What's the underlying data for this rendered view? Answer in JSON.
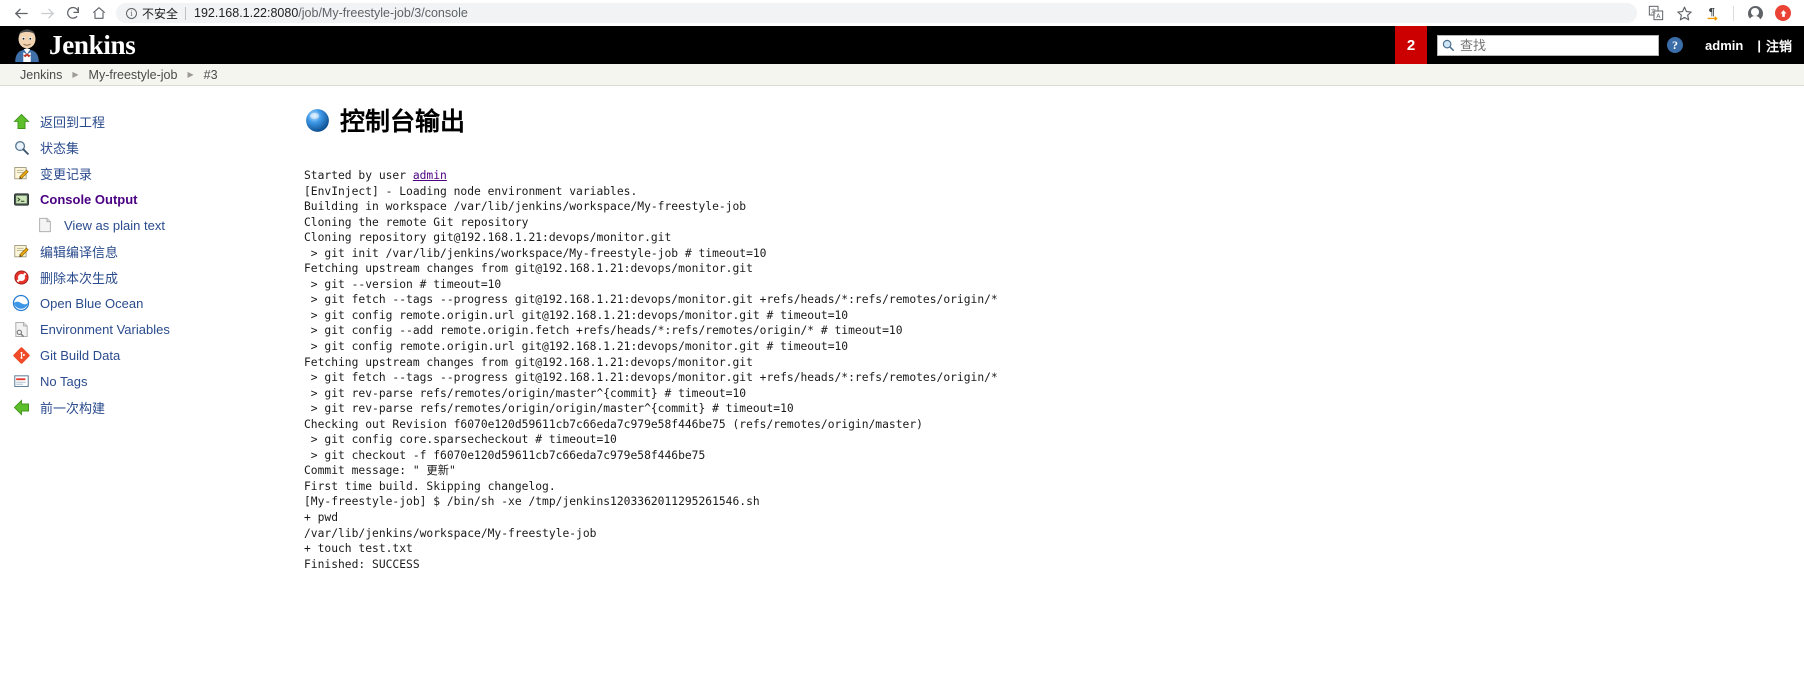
{
  "browser": {
    "back_icon": "arrow-left-icon",
    "forward_icon": "arrow-right-icon",
    "reload_icon": "reload-icon",
    "home_icon": "home-icon",
    "info_glyph": "i",
    "security_label": "不安全",
    "url_host": "192.168.1.22:8080",
    "url_path": "/job/My-freestyle-job/3/console",
    "translate_icon": "translate-icon",
    "bookmark_icon": "star-icon",
    "pilcrow_icon": "pilcrow-icon",
    "profile_icon": "profile-icon",
    "update_icon": "update-badge-icon"
  },
  "header": {
    "logo_icon": "jenkins-butler-icon",
    "title": "Jenkins",
    "build_count": "2",
    "search_placeholder": "查找",
    "search_value": "",
    "search_icon": "search-icon",
    "help_icon": "help-icon",
    "help_label": "?",
    "user": "admin",
    "separator": "|",
    "logout_label": "注销",
    "accent_red": "#cc0000"
  },
  "breadcrumb": {
    "items": [
      {
        "label": "Jenkins"
      },
      {
        "label": "My-freestyle-job"
      },
      {
        "label": "#3"
      }
    ],
    "arrow_icon": "chevron-right-icon"
  },
  "sidebar": {
    "items": [
      {
        "label": "返回到工程",
        "icon": "up-arrow-icon",
        "name": "back-to-project",
        "style": "plain"
      },
      {
        "label": "状态集",
        "icon": "magnifier-icon",
        "name": "status-set",
        "style": "plain"
      },
      {
        "label": "变更记录",
        "icon": "changes-icon",
        "name": "changes",
        "style": "plain"
      },
      {
        "label": "Console Output",
        "icon": "terminal-icon",
        "name": "console-output",
        "style": "active"
      },
      {
        "label": "View as plain text",
        "icon": "document-icon",
        "name": "view-as-plain-text",
        "style": "sub"
      },
      {
        "label": "编辑编译信息",
        "icon": "edit-icon",
        "name": "edit-build-information",
        "style": "plain"
      },
      {
        "label": "删除本次生成",
        "icon": "delete-icon",
        "name": "delete-build",
        "style": "plain"
      },
      {
        "label": "Open Blue Ocean",
        "icon": "blue-ocean-icon",
        "name": "open-blue-ocean",
        "style": "plain"
      },
      {
        "label": "Environment Variables",
        "icon": "env-vars-icon",
        "name": "environment-variables",
        "style": "plain"
      },
      {
        "label": "Git Build Data",
        "icon": "git-icon",
        "name": "git-build-data",
        "style": "plain"
      },
      {
        "label": "No Tags",
        "icon": "tag-icon",
        "name": "no-tags",
        "style": "plain"
      },
      {
        "label": "前一次构建",
        "icon": "prev-build-icon",
        "name": "previous-build",
        "style": "plain"
      }
    ]
  },
  "console": {
    "icon": "blue-sphere-icon",
    "title": "控制台输出",
    "lines": [
      {
        "text": "Started by user ",
        "link": "admin"
      },
      {
        "text": "[EnvInject] - Loading node environment variables."
      },
      {
        "text": "Building in workspace /var/lib/jenkins/workspace/My-freestyle-job"
      },
      {
        "text": "Cloning the remote Git repository"
      },
      {
        "text": "Cloning repository git@192.168.1.21:devops/monitor.git"
      },
      {
        "text": " > git init /var/lib/jenkins/workspace/My-freestyle-job # timeout=10"
      },
      {
        "text": "Fetching upstream changes from git@192.168.1.21:devops/monitor.git"
      },
      {
        "text": " > git --version # timeout=10"
      },
      {
        "text": " > git fetch --tags --progress git@192.168.1.21:devops/monitor.git +refs/heads/*:refs/remotes/origin/*"
      },
      {
        "text": " > git config remote.origin.url git@192.168.1.21:devops/monitor.git # timeout=10"
      },
      {
        "text": " > git config --add remote.origin.fetch +refs/heads/*:refs/remotes/origin/* # timeout=10"
      },
      {
        "text": " > git config remote.origin.url git@192.168.1.21:devops/monitor.git # timeout=10"
      },
      {
        "text": "Fetching upstream changes from git@192.168.1.21:devops/monitor.git"
      },
      {
        "text": " > git fetch --tags --progress git@192.168.1.21:devops/monitor.git +refs/heads/*:refs/remotes/origin/*"
      },
      {
        "text": " > git rev-parse refs/remotes/origin/master^{commit} # timeout=10"
      },
      {
        "text": " > git rev-parse refs/remotes/origin/origin/master^{commit} # timeout=10"
      },
      {
        "text": "Checking out Revision f6070e120d59611cb7c66eda7c979e58f446be75 (refs/remotes/origin/master)"
      },
      {
        "text": " > git config core.sparsecheckout # timeout=10"
      },
      {
        "text": " > git checkout -f f6070e120d59611cb7c66eda7c979e58f446be75"
      },
      {
        "text": "Commit message: \" 更新\""
      },
      {
        "text": "First time build. Skipping changelog."
      },
      {
        "text": "[My-freestyle-job] $ /bin/sh -xe /tmp/jenkins1203362011295261546.sh"
      },
      {
        "text": "+ pwd"
      },
      {
        "text": "/var/lib/jenkins/workspace/My-freestyle-job"
      },
      {
        "text": "+ touch test.txt"
      },
      {
        "text": "Finished: SUCCESS"
      }
    ]
  }
}
